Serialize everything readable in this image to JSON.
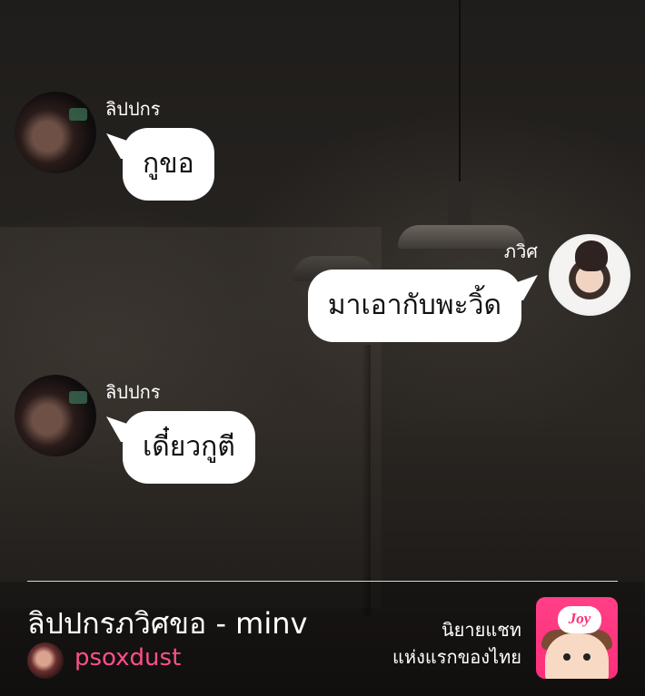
{
  "messages": [
    {
      "sender": "ลิปปกร",
      "text": "กูขอ",
      "side": "left"
    },
    {
      "sender": "ภวิศ",
      "text": "มาเอากับพะวิ้ด",
      "side": "right"
    },
    {
      "sender": "ลิปปกร",
      "text": "เดี๋ยวกูตี",
      "side": "left"
    }
  ],
  "footer": {
    "story_title": "ลิปปกรภวิศขอ - minv",
    "author": "psoxdust",
    "promo_line1": "นิยายแชท",
    "promo_line2": "แห่งแรกของไทย",
    "logo_text": "Joy"
  },
  "colors": {
    "author": "#ff4f8b",
    "logo_bg": "#ff2f7a",
    "bubble": "#ffffff"
  }
}
